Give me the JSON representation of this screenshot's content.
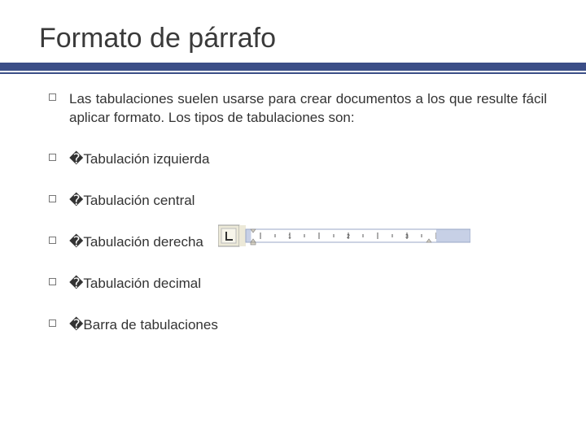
{
  "title": "Formato de párrafo",
  "intro": "Las tabulaciones suelen usarse para crear documentos a los que resulte fácil aplicar formato. Los tipos de tabulaciones son:",
  "items": {
    "t1": "�Tabulación izquierda",
    "t2": "�Tabulación central",
    "t3": "�Tabulación derecha",
    "t4": "�Tabulación decimal",
    "t5": "�Barra de tabulaciones"
  },
  "colors": {
    "accent": "#3b4e87"
  }
}
